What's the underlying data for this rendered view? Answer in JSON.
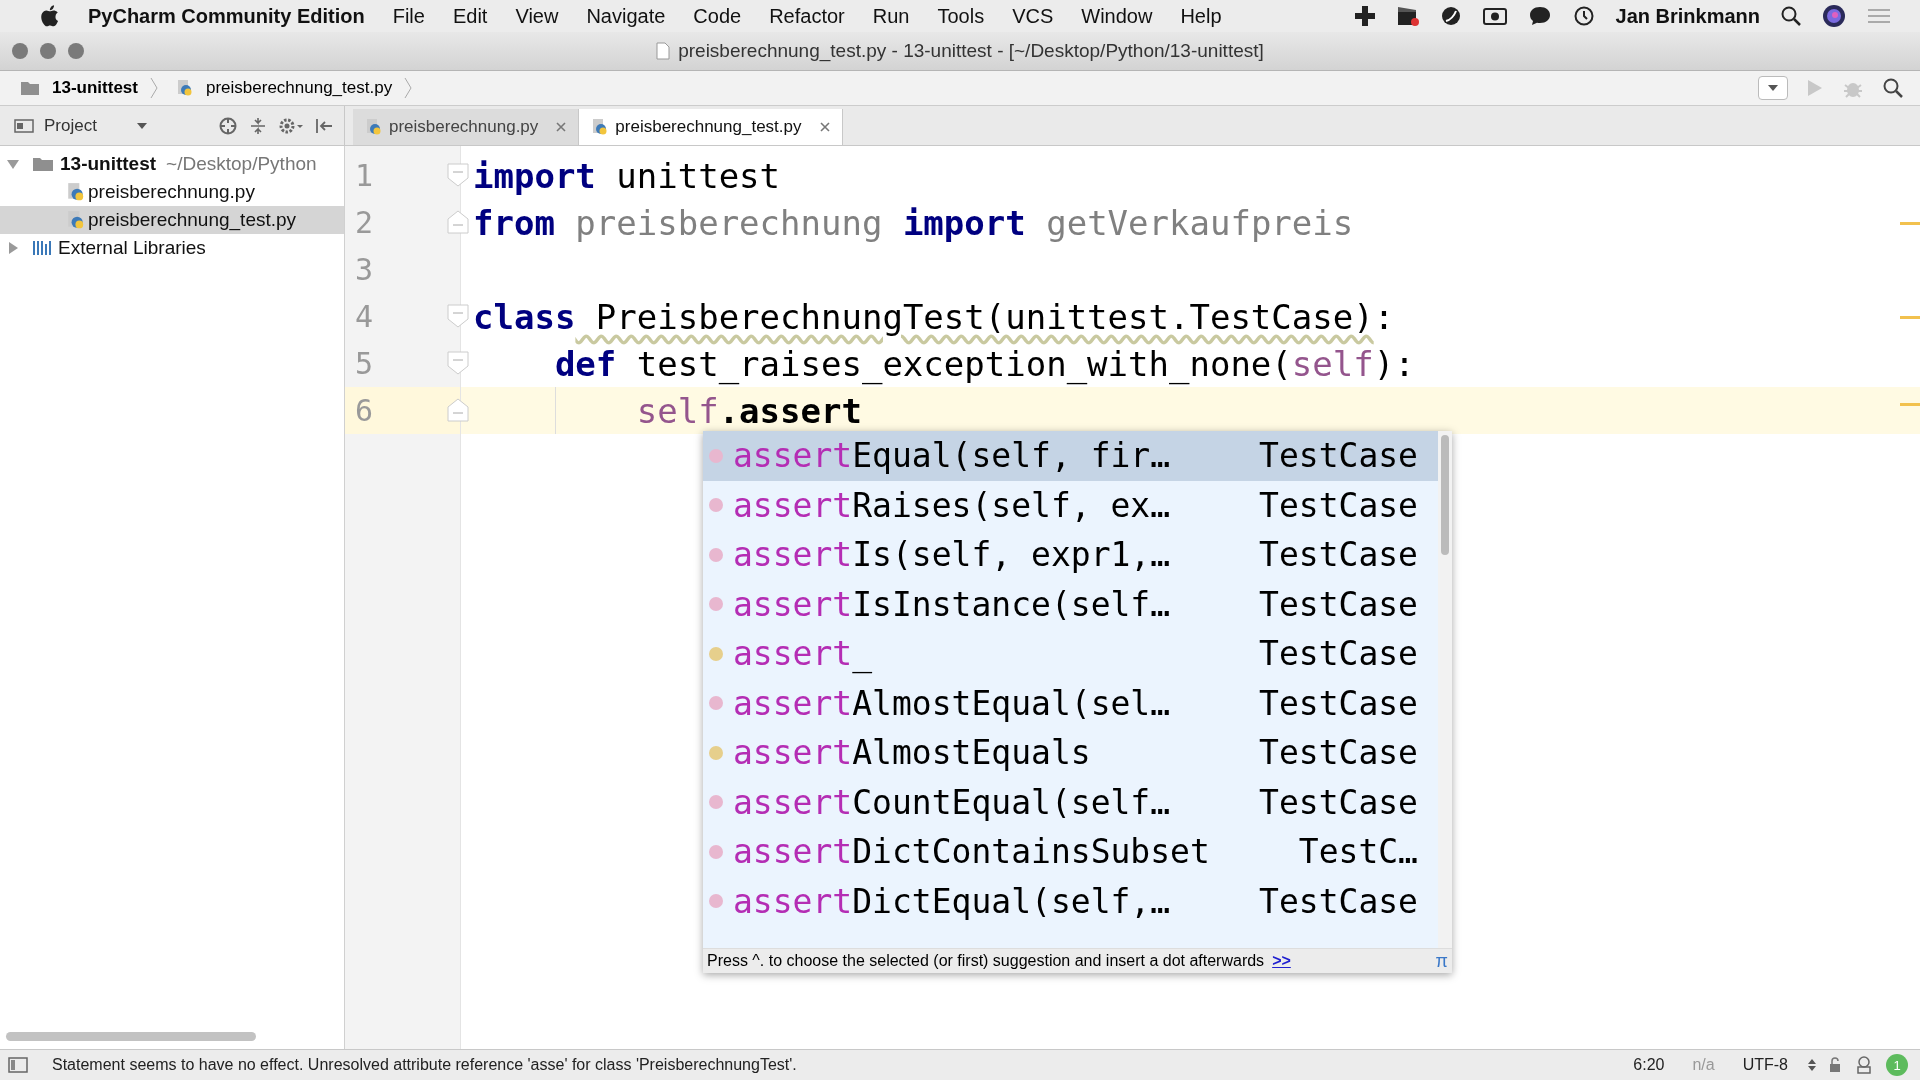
{
  "menu_bar": {
    "app_name": "PyCharm Community Edition",
    "items": [
      "File",
      "Edit",
      "View",
      "Navigate",
      "Code",
      "Refactor",
      "Run",
      "Tools",
      "VCS",
      "Window",
      "Help"
    ],
    "user": "Jan Brinkmann"
  },
  "window": {
    "title": "preisberechnung_test.py - 13-unittest - [~/Desktop/Python/13-unittest]"
  },
  "breadcrumbs": [
    "13-unittest",
    "preisberechnung_test.py"
  ],
  "project_panel": {
    "title": "Project",
    "tree": [
      {
        "label": "13-unittest",
        "hint": "~/Desktop/Python",
        "kind": "folder",
        "expanded": true,
        "selected": false,
        "children": [
          {
            "label": "preisberechnung.py",
            "kind": "python",
            "selected": false
          },
          {
            "label": "preisberechnung_test.py",
            "kind": "python",
            "selected": true
          }
        ]
      },
      {
        "label": "External Libraries",
        "kind": "library",
        "expanded": false,
        "selected": false
      }
    ]
  },
  "tabs": [
    {
      "label": "preisberechnung.py",
      "selected": false
    },
    {
      "label": "preisberechnung_test.py",
      "selected": true
    }
  ],
  "code": [
    {
      "number": "1",
      "current": false,
      "segments": [
        {
          "text": "import",
          "kind": "keyword"
        },
        {
          "text": " unittest",
          "kind": "plain"
        }
      ]
    },
    {
      "number": "2",
      "current": false,
      "segments": [
        {
          "text": "from",
          "kind": "keyword"
        },
        {
          "text": " preisberechnung ",
          "kind": "unused"
        },
        {
          "text": "import",
          "kind": "keyword"
        },
        {
          "text": " getVerkaufpreis",
          "kind": "unused"
        }
      ]
    },
    {
      "number": "3",
      "current": false
    },
    {
      "number": "4",
      "current": false,
      "segments": [
        {
          "text": "class",
          "kind": "keyword"
        },
        {
          "text": " PreisberechnungTest(unittest.TestCase)",
          "kind": "warning"
        },
        {
          "text": ":",
          "kind": "plain"
        }
      ],
      "children": [
        {
          "number": "5",
          "current": false,
          "segments": [
            {
              "text": "def",
              "kind": "keyword"
            },
            {
              "text": " test_raises_exception_with_none(",
              "kind": "plain"
            },
            {
              "text": "self",
              "kind": "self"
            },
            {
              "text": "):",
              "kind": "plain"
            }
          ],
          "children": [
            {
              "number": "6",
              "current": true,
              "segments": [
                {
                  "text": "self",
                  "kind": "self"
                },
                {
                  "text": ".assert",
                  "kind": "bold"
                }
              ]
            }
          ]
        }
      ]
    }
  ],
  "completion": {
    "items": [
      {
        "kind": "method",
        "match": "assert",
        "rest": "Equal(self, fir…",
        "type": "TestCase",
        "selected": true
      },
      {
        "kind": "method",
        "match": "assert",
        "rest": "Raises(self, ex…",
        "type": "TestCase",
        "selected": false
      },
      {
        "kind": "method",
        "match": "assert",
        "rest": "Is(self, expr1,…",
        "type": "TestCase",
        "selected": false
      },
      {
        "kind": "method",
        "match": "assert",
        "rest": "IsInstance(self…",
        "type": "TestCase",
        "selected": false
      },
      {
        "kind": "field",
        "match": "assert",
        "rest": "_",
        "type": "TestCase",
        "selected": false
      },
      {
        "kind": "method",
        "match": "assert",
        "rest": "AlmostEqual(sel…",
        "type": "TestCase",
        "selected": false
      },
      {
        "kind": "field",
        "match": "assert",
        "rest": "AlmostEquals",
        "type": "TestCase",
        "selected": false
      },
      {
        "kind": "method",
        "match": "assert",
        "rest": "CountEqual(self…",
        "type": "TestCase",
        "selected": false
      },
      {
        "kind": "method",
        "match": "assert",
        "rest": "DictContainsSubset",
        "type": "TestC…",
        "selected": false
      },
      {
        "kind": "method",
        "match": "assert",
        "rest": "DictEqual(self,…",
        "type": "TestCase",
        "selected": false
      }
    ],
    "hint": "Press ^. to choose the selected (or first) suggestion and insert a dot afterwards",
    "hint_link": ">>",
    "pi": "π"
  },
  "status_bar": {
    "message": "Statement seems to have no effect. Unresolved attribute reference 'asse' for class 'PreisberechnungTest'.",
    "position": "6:20",
    "line_sep": "n/a",
    "encoding": "UTF-8",
    "badge": "1"
  }
}
